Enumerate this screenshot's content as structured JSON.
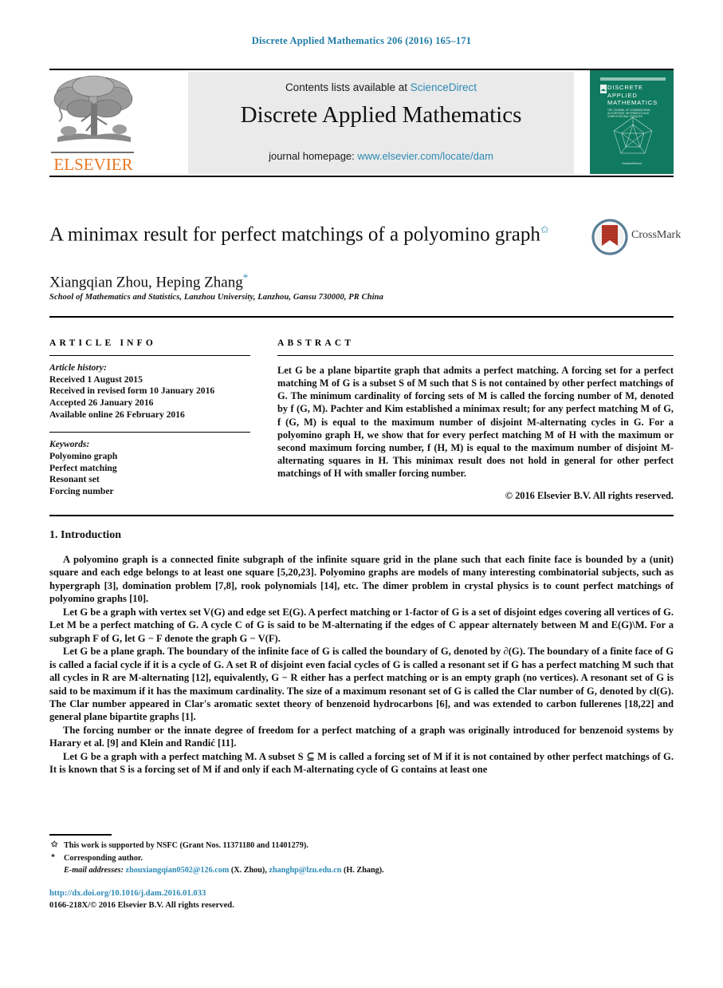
{
  "running_head": "Discrete Applied Mathematics 206 (2016) 165–171",
  "masthead": {
    "contents_prefix": "Contents lists available at ",
    "contents_link": "ScienceDirect",
    "journal_name": "Discrete Applied Mathematics",
    "homepage_prefix": "journal homepage: ",
    "homepage_link": "www.elsevier.com/locate/dam",
    "publisher_wordmark": "ELSEVIER",
    "cover": {
      "title": "DISCRETE APPLIED MATHEMATICS",
      "subtitle": "THE JOURNAL OF COMBINATORIAL ALGORITHMS, INFORMATICS AND COMPUTATIONAL SCIENCES",
      "footer": "ScienceDirect"
    }
  },
  "article": {
    "title": "A minimax result for perfect matchings of a polyomino graph",
    "title_footnote_mark": "✩",
    "authors": "Xiangqian Zhou, Heping Zhang",
    "corresponding_mark": "*",
    "affiliation": "School of Mathematics and Statistics, Lanzhou University, Lanzhou, Gansu 730000, PR China",
    "crossmark_label": "CrossMark"
  },
  "info": {
    "heading": "ARTICLE INFO",
    "history_label": "Article history:",
    "history": [
      "Received 1 August 2015",
      "Received in revised form 10 January 2016",
      "Accepted 26 January 2016",
      "Available online 26 February 2016"
    ],
    "keywords_label": "Keywords:",
    "keywords": [
      "Polyomino graph",
      "Perfect matching",
      "Resonant set",
      "Forcing number"
    ]
  },
  "abstract": {
    "heading": "ABSTRACT",
    "text": "Let G be a plane bipartite graph that admits a perfect matching. A forcing set for a perfect matching M of G is a subset S of M such that S is not contained by other perfect matchings of G. The minimum cardinality of forcing sets of M is called the forcing number of M, denoted by f (G, M). Pachter and Kim established a minimax result; for any perfect matching M of G, f (G, M) is equal to the maximum number of disjoint M-alternating cycles in G. For a polyomino graph H, we show that for every perfect matching M of H with the maximum or second maximum forcing number, f (H, M) is equal to the maximum number of disjoint M-alternating squares in H. This minimax result does not hold in general for other perfect matchings of H with smaller forcing number.",
    "copyright": "© 2016 Elsevier B.V. All rights reserved."
  },
  "body": {
    "section_number_title": "1. Introduction",
    "paragraphs": [
      "A polyomino graph is a connected finite subgraph of the infinite square grid in the plane such that each finite face is bounded by a (unit) square and each edge belongs to at least one square [5,20,23]. Polyomino graphs are models of many interesting combinatorial subjects, such as hypergraph [3], domination problem [7,8], rook polynomials [14], etc. The dimer problem in crystal physics is to count perfect matchings of polyomino graphs [10].",
      "Let G be a graph with vertex set V(G) and edge set E(G). A perfect matching or 1-factor of G is a set of disjoint edges covering all vertices of G. Let M be a perfect matching of G. A cycle C of G is said to be M-alternating if the edges of C appear alternately between M and E(G)\\M. For a subgraph F of G, let G − F denote the graph G − V(F).",
      "Let G be a plane graph. The boundary of the infinite face of G is called the boundary of G, denoted by ∂(G). The boundary of a finite face of G is called a facial cycle if it is a cycle of G. A set R of disjoint even facial cycles of G is called a resonant set if G has a perfect matching M such that all cycles in R are M-alternating [12], equivalently, G − R either has a perfect matching or is an empty graph (no vertices). A resonant set of G is said to be maximum if it has the maximum cardinality. The size of a maximum resonant set of G is called the Clar number of G, denoted by cl(G). The Clar number appeared in Clar's aromatic sextet theory of benzenoid hydrocarbons [6], and was extended to carbon fullerenes [18,22] and general plane bipartite graphs [1].",
      "The forcing number or the innate degree of freedom for a perfect matching of a graph was originally introduced for benzenoid systems by Harary et al. [9] and Klein and Randić [11].",
      "Let G be a graph with a perfect matching M. A subset S ⊆ M is called a forcing set of M if it is not contained by other perfect matchings of G. It is known that S is a forcing set of M if and only if each M-alternating cycle of G contains at least one"
    ]
  },
  "footnotes": {
    "grant_mark": "✩",
    "grant": "This work is supported by NSFC (Grant Nos. 11371180 and 11401279).",
    "corresponding_mark": "*",
    "corresponding": "Corresponding author.",
    "email_label": "E-mail addresses:",
    "emails": [
      {
        "address": "zhouxiangqian0502@126.com",
        "who": "(X. Zhou)"
      },
      {
        "address": "zhanghp@lzu.edu.cn",
        "who": "(H. Zhang)"
      }
    ],
    "doi": "http://dx.doi.org/10.1016/j.dam.2016.01.033",
    "issn_line": "0166-218X/© 2016 Elsevier B.V. All rights reserved."
  },
  "colors": {
    "link": "#2e8ab5",
    "elsevier_orange": "#e87722",
    "cover_green": "#0f7a5f",
    "crossmark_red": "#c0392b"
  }
}
